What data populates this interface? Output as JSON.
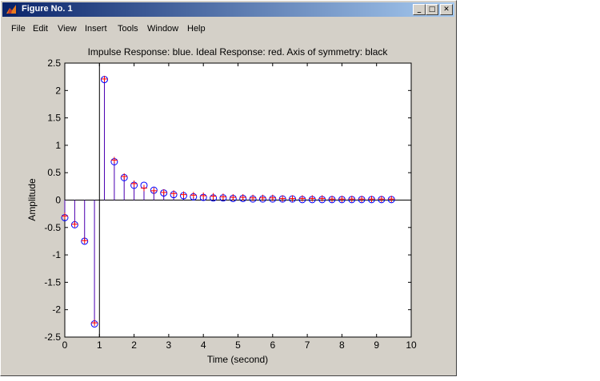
{
  "window": {
    "title": "Figure No. 1"
  },
  "title_buttons": {
    "minimize": "_",
    "maximize": "□",
    "close": "✕"
  },
  "menu": [
    "File",
    "Edit",
    "View",
    "Insert",
    "Tools",
    "Window",
    "Help"
  ],
  "chart_data": {
    "type": "stem",
    "title": "Impulse Response: blue. Ideal Response: red. Axis of symmetry: black",
    "xlabel": "Time (second)",
    "ylabel": "Amplitude",
    "xlim": [
      0,
      10
    ],
    "ylim": [
      -2.5,
      2.5
    ],
    "xticks": [
      "0",
      "1",
      "2",
      "3",
      "4",
      "5",
      "6",
      "7",
      "8",
      "9",
      "10"
    ],
    "yticks": [
      "2.5",
      "2",
      "1.5",
      "1",
      "0.5",
      "0",
      "-0.5",
      "-1",
      "-1.5",
      "-2",
      "-2.5"
    ],
    "axis_of_symmetry_x": 1.0,
    "colors": {
      "impulse": "#0000ff",
      "ideal": "#ff0000",
      "symmetry": "#000000"
    },
    "series": [
      {
        "name": "Impulse Response",
        "marker": "circle",
        "x": [
          0,
          0.286,
          0.571,
          0.857,
          1.143,
          1.429,
          1.714,
          2.0,
          2.286,
          2.571,
          2.857,
          3.143,
          3.429,
          3.714,
          4.0,
          4.286,
          4.571,
          4.857,
          5.143,
          5.429,
          5.714,
          6.0,
          6.286,
          6.571,
          6.857,
          7.143,
          7.429,
          7.714,
          8.0,
          8.286,
          8.571,
          8.857,
          9.143,
          9.429
        ],
        "y": [
          -0.32,
          -0.45,
          -0.75,
          -2.26,
          2.2,
          0.7,
          0.41,
          0.27,
          0.27,
          0.18,
          0.13,
          0.1,
          0.08,
          0.06,
          0.05,
          0.04,
          0.04,
          0.03,
          0.03,
          0.02,
          0.02,
          0.02,
          0.02,
          0.02,
          0.01,
          0.01,
          0.01,
          0.01,
          0.01,
          0.01,
          0.01,
          0.01,
          0.01,
          0.01
        ]
      },
      {
        "name": "Ideal Response",
        "marker": "plus",
        "x": [
          0,
          0.286,
          0.571,
          0.857,
          1.143,
          1.429,
          1.714,
          2.0,
          2.286,
          2.571,
          2.857,
          3.143,
          3.429,
          3.714,
          4.0,
          4.286,
          4.571,
          4.857,
          5.143,
          5.429,
          5.714,
          6.0,
          6.286,
          6.571,
          6.857,
          7.143,
          7.429,
          7.714,
          8.0,
          8.286,
          8.571,
          8.857,
          9.143,
          9.429
        ],
        "y": [
          -0.29,
          -0.44,
          -0.74,
          -2.24,
          2.21,
          0.73,
          0.43,
          0.3,
          0.22,
          0.17,
          0.14,
          0.12,
          0.1,
          0.09,
          0.08,
          0.07,
          0.06,
          0.05,
          0.05,
          0.04,
          0.04,
          0.04,
          0.03,
          0.03,
          0.03,
          0.03,
          0.03,
          0.02,
          0.02,
          0.02,
          0.02,
          0.02,
          0.02,
          0.02
        ]
      }
    ]
  }
}
